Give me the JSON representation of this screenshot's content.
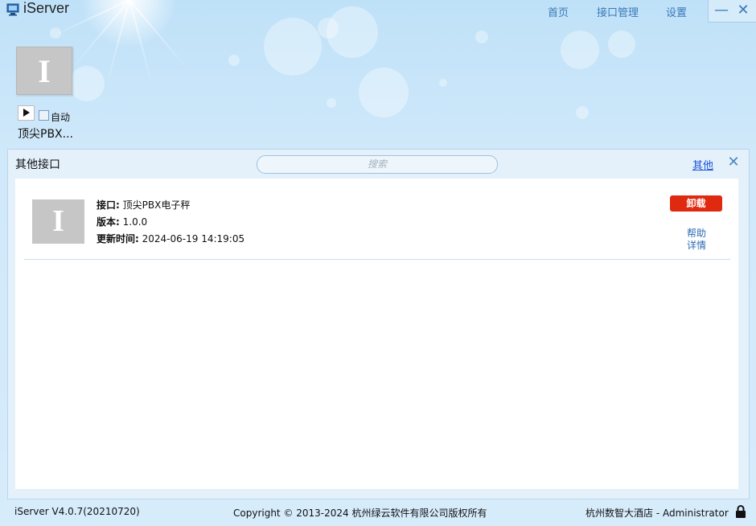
{
  "app": {
    "title": "iServer",
    "icon": "monitor-icon"
  },
  "nav": {
    "home": "首页",
    "interface_manage": "接口管理",
    "settings": "设置"
  },
  "window_controls": {
    "minimize": "—",
    "close": "✕"
  },
  "installed": {
    "tile_letter": "I",
    "auto_label": "自动",
    "auto_checked": false,
    "name": "顶尖PBX..."
  },
  "panel": {
    "title": "其他接口",
    "search_placeholder": "搜索",
    "other_link": "其他",
    "close": "✕"
  },
  "plugin": {
    "letter": "I",
    "interface_label": "接口:",
    "interface_value": "顶尖PBX电子秤",
    "version_label": "版本:",
    "version_value": "1.0.0",
    "updated_label": "更新时间:",
    "updated_value": "2024-06-19 14:19:05",
    "uninstall_label": "卸载",
    "help_label": "帮助",
    "details_label": "详情"
  },
  "status_bar": {
    "version": "iServer V4.0.7(20210720)",
    "copyright": "Copyright © 2013-2024 杭州绿云软件有限公司版权所有",
    "user": "杭州数智大酒店 - Administrator"
  },
  "colors": {
    "accent": "#3a79b7",
    "danger": "#e02a10",
    "link": "#1a54d6"
  }
}
